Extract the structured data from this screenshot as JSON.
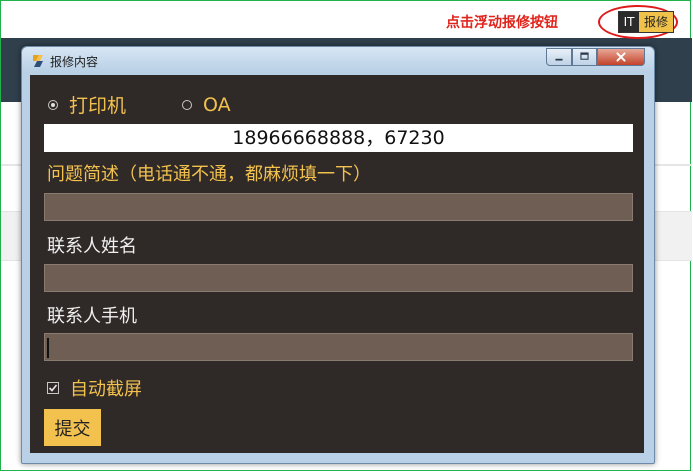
{
  "hint_text": "点击浮动报修按钮",
  "float_button": {
    "it_text": "IT",
    "label": "报修"
  },
  "window": {
    "title": "报修内容",
    "controls": {
      "minimize": "minimize-icon",
      "maximize": "maximize-icon",
      "close": "close-icon"
    }
  },
  "form": {
    "category_options": [
      {
        "label": "打印机",
        "selected": true
      },
      {
        "label": "OA",
        "selected": false
      }
    ],
    "contact_numbers": "18966668888，67230",
    "description_label": "问题简述（电话通不通，都麻烦填一下）",
    "description_value": "",
    "contact_name_label": "联系人姓名",
    "contact_name_value": "",
    "contact_phone_label": "联系人手机",
    "contact_phone_value": "",
    "auto_screenshot_label": "自动截屏",
    "auto_screenshot_checked": true,
    "submit_label": "提交"
  },
  "colors": {
    "accent_gold": "#f2c14e",
    "panel_bg": "#2f2927",
    "field_bg": "#6e5e54",
    "hint_red": "#e0241c",
    "frame_green": "#22b24c"
  }
}
